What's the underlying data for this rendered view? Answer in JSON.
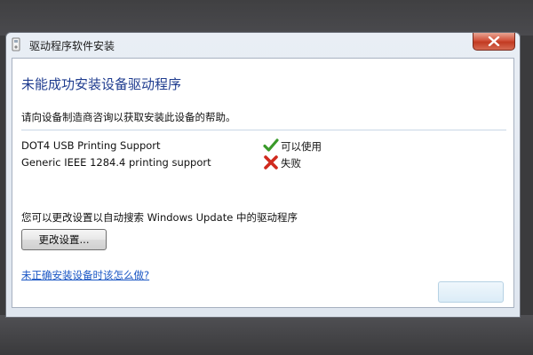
{
  "window": {
    "title": "驱动程序软件安装"
  },
  "content": {
    "heading": "未能成功安装设备驱动程序",
    "description": "请向设备制造商咨询以获取安装此设备的帮助。",
    "devices": [
      {
        "name": "DOT4 USB Printing Support",
        "status": "可以使用",
        "status_icon": "check-icon",
        "status_color": "#3a9a2a"
      },
      {
        "name": "Generic IEEE 1284.4 printing support",
        "status": "失败",
        "status_icon": "x-icon",
        "status_color": "#d02a1e"
      }
    ],
    "hint": "您可以更改设置以自动搜索 Windows Update 中的驱动程序",
    "change_settings_label": "更改设置...",
    "help_link": "未正确安装设备时该怎么做?"
  }
}
